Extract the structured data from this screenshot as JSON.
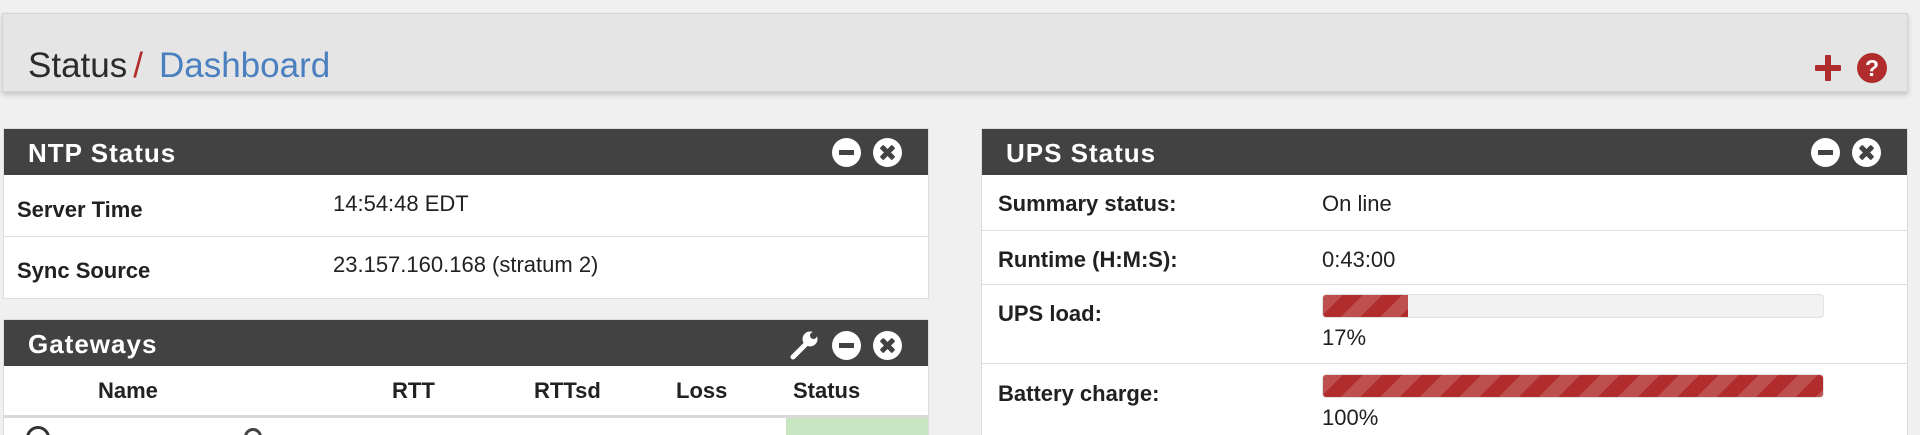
{
  "breadcrumb": {
    "section": "Status",
    "separator": "/",
    "page": "Dashboard"
  },
  "header_icons": [
    "plus-icon",
    "question-circle-icon"
  ],
  "colors": {
    "accent": "#b12d2d",
    "link": "#4a7fc0",
    "panel_header": "#424242",
    "status_ok": "#c9e6c3"
  },
  "ntp": {
    "title": "NTP Status",
    "rows": [
      {
        "label": "Server Time",
        "value": "14:54:48 EDT"
      },
      {
        "label": "Sync Source",
        "value": "23.157.160.168 (stratum 2)"
      }
    ]
  },
  "gateways": {
    "title": "Gateways",
    "columns": {
      "name": "Name",
      "rtt": "RTT",
      "rttsd": "RTTsd",
      "loss": "Loss",
      "status": "Status"
    }
  },
  "ups": {
    "title": "UPS Status",
    "summary": {
      "label": "Summary status:",
      "value": "On line"
    },
    "runtime": {
      "label": "Runtime (H:M:S):",
      "value": "0:43:00"
    },
    "load": {
      "label": "UPS load:",
      "value_text": "17%",
      "fraction": 0.17
    },
    "battery": {
      "label": "Battery charge:",
      "value_text": "100%",
      "fraction": 1.0
    }
  }
}
